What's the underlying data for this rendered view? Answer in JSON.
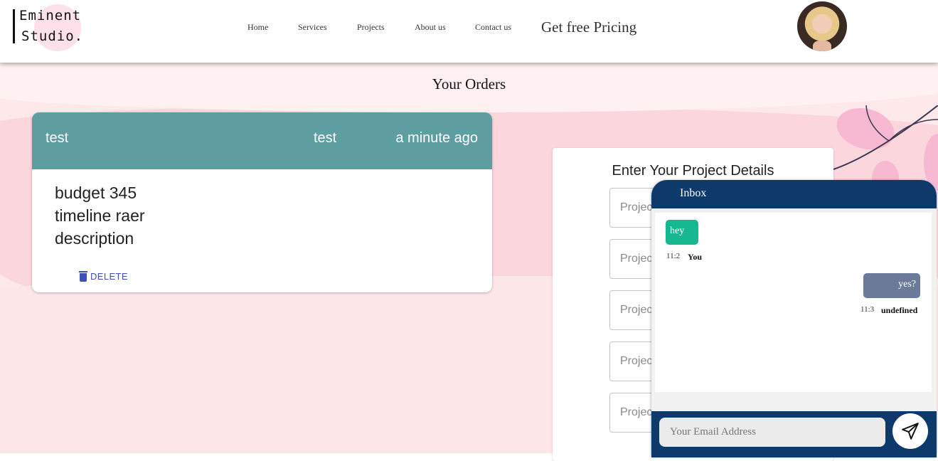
{
  "logo": {
    "line1": "Eminent",
    "line2": "Studio."
  },
  "nav": {
    "items": [
      {
        "label": "Home"
      },
      {
        "label": "Services"
      },
      {
        "label": "Projects"
      },
      {
        "label": "About us"
      },
      {
        "label": "Contact us"
      }
    ],
    "pricing": "Get free Pricing"
  },
  "page": {
    "title": "Your Orders"
  },
  "order": {
    "name": "test",
    "client": "test",
    "time": "a minute ago",
    "budget": "budget 345",
    "timeline": "timeline raer",
    "description": "description",
    "delete_label": "DELETE"
  },
  "project_form": {
    "title": "Enter Your Project Details",
    "placeholders": [
      "Project",
      "Project",
      "Project",
      "Project",
      "Project"
    ]
  },
  "chat": {
    "title": "Inbox",
    "messages": [
      {
        "text": "hey",
        "time": "11:2",
        "sender": "You"
      },
      {
        "text": "yes?",
        "time": "11:3",
        "sender": "undefined"
      }
    ],
    "input_placeholder": "Your Email Address"
  },
  "colors": {
    "order_header": "#5f9ea0",
    "chat_header": "#0e3a6b",
    "my_bubble": "#17b890",
    "their_bubble": "#6b7a99",
    "delete": "#3f51b5"
  }
}
